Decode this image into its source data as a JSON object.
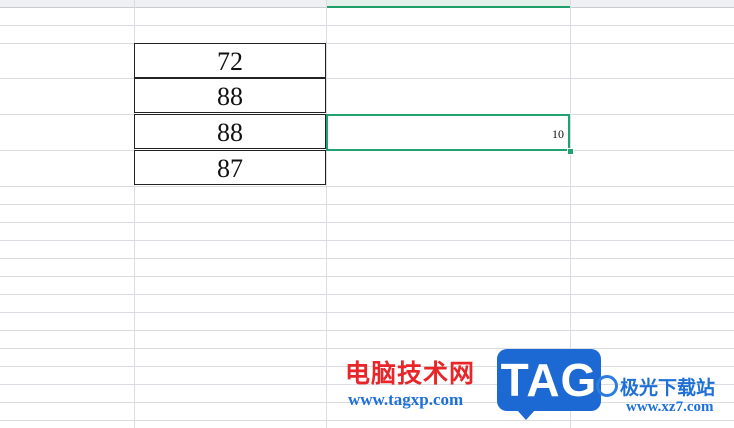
{
  "sheet": {
    "cells": [
      {
        "value": "72"
      },
      {
        "value": "88"
      },
      {
        "value": "88"
      },
      {
        "value": "87"
      }
    ],
    "selected_cell": {
      "value": "10"
    }
  },
  "watermark": {
    "left_text": "电脑技术网",
    "left_url": "www.tagxp.com",
    "badge": "TAG",
    "site_name": "极光下载站",
    "site_url": "www.xz7.com"
  },
  "colors": {
    "selection": "#21a36f",
    "gridline": "#d9dde2",
    "watermark_red": "#e8262a",
    "watermark_blue": "#1c69d4"
  }
}
